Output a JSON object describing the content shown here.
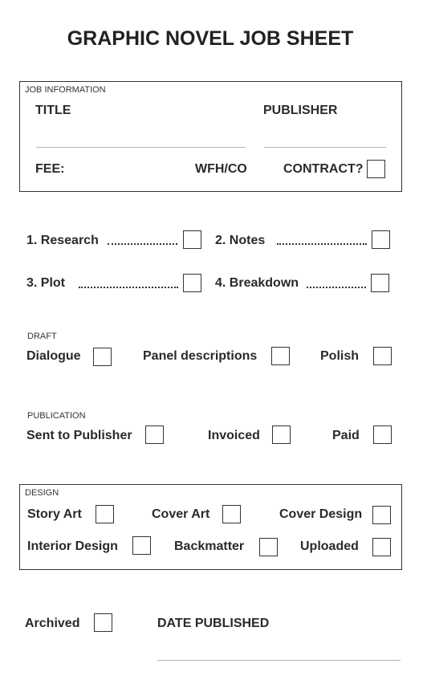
{
  "title": "GRAPHIC NOVEL JOB SHEET",
  "job_information": {
    "section_label": "JOB INFORMATION",
    "title_label": "TITLE",
    "title_value": "",
    "publisher_label": "PUBLISHER",
    "publisher_value": "",
    "fee_label": "FEE:",
    "wfh_label": "WFH/CO",
    "contract_label": "CONTRACT?",
    "contract_checked": false
  },
  "steps": [
    {
      "label": "1. Research",
      "checked": false
    },
    {
      "label": "2. Notes",
      "checked": false
    },
    {
      "label": "3. Plot",
      "checked": false
    },
    {
      "label": "4. Breakdown",
      "checked": false
    }
  ],
  "draft": {
    "section_label": "DRAFT",
    "items": [
      {
        "label": "Dialogue",
        "checked": false
      },
      {
        "label": "Panel descriptions",
        "checked": false
      },
      {
        "label": "Polish",
        "checked": false
      }
    ]
  },
  "publication": {
    "section_label": "PUBLICATION",
    "items": [
      {
        "label": "Sent to Publisher",
        "checked": false
      },
      {
        "label": "Invoiced",
        "checked": false
      },
      {
        "label": "Paid",
        "checked": false
      }
    ]
  },
  "design": {
    "section_label": "DESIGN",
    "items": [
      {
        "label": "Story Art",
        "checked": false
      },
      {
        "label": "Cover Art",
        "checked": false
      },
      {
        "label": "Cover Design",
        "checked": false
      },
      {
        "label": "Interior Design",
        "checked": false
      },
      {
        "label": "Backmatter",
        "checked": false
      },
      {
        "label": "Uploaded",
        "checked": false
      }
    ]
  },
  "footer": {
    "archived_label": "Archived",
    "archived_checked": false,
    "date_published_label": "DATE PUBLISHED",
    "date_published_value": ""
  }
}
